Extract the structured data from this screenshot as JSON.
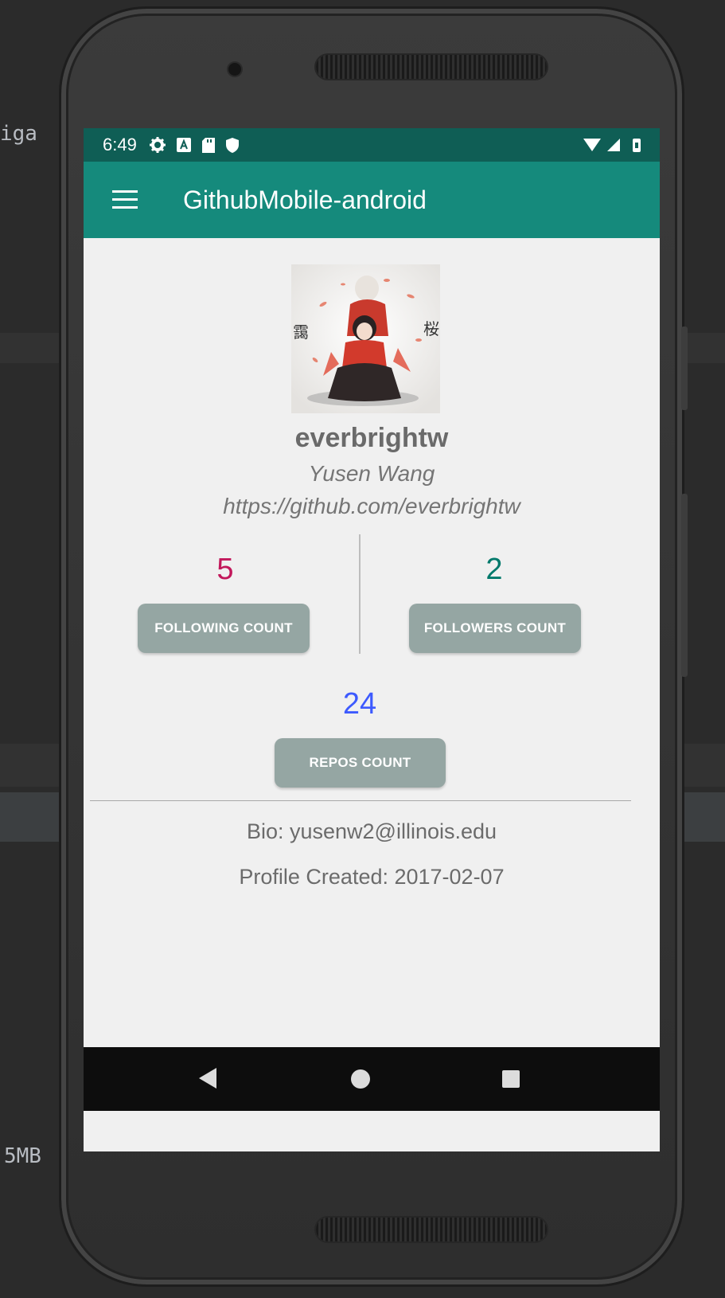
{
  "ide_background": {
    "fragment_top": "iga",
    "fragment_bottom": "5MB"
  },
  "status_bar": {
    "time": "6:49",
    "left_icons": [
      "gear-icon",
      "font-a-icon",
      "sd-card-icon",
      "shield-icon"
    ],
    "right_icons": [
      "wifi-icon",
      "cell-signal-icon",
      "battery-icon"
    ]
  },
  "app_bar": {
    "title": "GithubMobile-android",
    "menu_icon": "hamburger-menu-icon"
  },
  "profile": {
    "username": "everbrightw",
    "full_name": "Yusen Wang",
    "url": "https://github.com/everbrightw"
  },
  "stats": {
    "following": {
      "count": "5",
      "label": "FOLLOWING COUNT",
      "color": "#c2185b"
    },
    "followers": {
      "count": "2",
      "label": "FOLLOWERS COUNT",
      "color": "#00796b"
    },
    "repos": {
      "count": "24",
      "label": "REPOS COUNT",
      "color": "#3d5afe"
    }
  },
  "info": {
    "bio": "Bio: yusenw2@illinois.edu",
    "created": "Profile Created: 2017-02-07"
  },
  "nav_bar": {
    "icons": [
      "back-icon",
      "home-icon",
      "recent-apps-icon"
    ]
  },
  "colors": {
    "status_bar": "#0f5e55",
    "app_bar": "#158a7c",
    "button": "#95a6a3",
    "screen_bg": "#f0f0f0"
  }
}
